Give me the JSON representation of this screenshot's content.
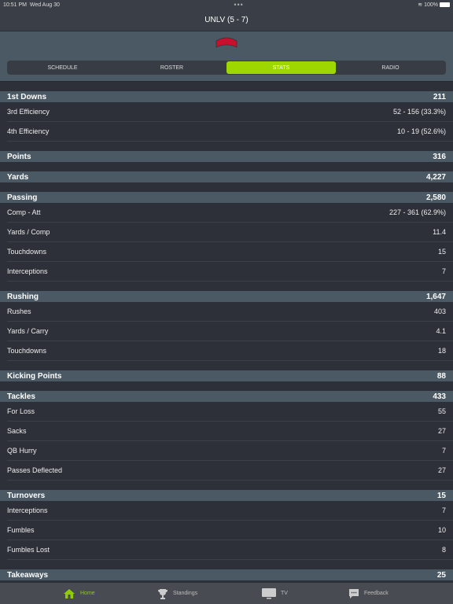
{
  "status": {
    "time": "10:51 PM",
    "date": "Wed Aug 30",
    "battery": "100%"
  },
  "nav": {
    "title": "UNLV (5 - 7)"
  },
  "logo": {
    "text": "UNLV",
    "color": "#c8102e"
  },
  "tabs": [
    {
      "label": "SCHEDULE"
    },
    {
      "label": "ROSTER"
    },
    {
      "label": "STATS",
      "active": true
    },
    {
      "label": "RADIO"
    }
  ],
  "accent": "#9ed600",
  "sections": [
    {
      "title": "1st Downs",
      "value": "211",
      "rows": [
        {
          "label": "3rd Efficiency",
          "value": "52 - 156 (33.3%)"
        },
        {
          "label": "4th Efficiency",
          "value": "10 - 19 (52.6%)"
        }
      ]
    },
    {
      "title": "Points",
      "value": "316",
      "rows": []
    },
    {
      "title": "Yards",
      "value": "4,227",
      "rows": []
    },
    {
      "title": "Passing",
      "value": "2,580",
      "rows": [
        {
          "label": "Comp - Att",
          "value": "227 - 361 (62.9%)"
        },
        {
          "label": "Yards / Comp",
          "value": "11.4"
        },
        {
          "label": "Touchdowns",
          "value": "15"
        },
        {
          "label": "Interceptions",
          "value": "7"
        }
      ]
    },
    {
      "title": "Rushing",
      "value": "1,647",
      "rows": [
        {
          "label": "Rushes",
          "value": "403"
        },
        {
          "label": "Yards / Carry",
          "value": "4.1"
        },
        {
          "label": "Touchdowns",
          "value": "18"
        }
      ]
    },
    {
      "title": "Kicking Points",
      "value": "88",
      "rows": []
    },
    {
      "title": "Tackles",
      "value": "433",
      "rows": [
        {
          "label": "For Loss",
          "value": "55"
        },
        {
          "label": "Sacks",
          "value": "27"
        },
        {
          "label": "QB Hurry",
          "value": "7"
        },
        {
          "label": "Passes Deflected",
          "value": "27"
        }
      ]
    },
    {
      "title": "Turnovers",
      "value": "15",
      "rows": [
        {
          "label": "Interceptions",
          "value": "7"
        },
        {
          "label": "Fumbles",
          "value": "10"
        },
        {
          "label": "Fumbles Lost",
          "value": "8"
        }
      ]
    },
    {
      "title": "Takeaways",
      "value": "25",
      "rows": []
    }
  ],
  "tabbar": [
    {
      "label": "Home",
      "icon": "home-icon",
      "active": true
    },
    {
      "label": "Standings",
      "icon": "trophy-icon"
    },
    {
      "label": "TV",
      "icon": "tv-icon"
    },
    {
      "label": "Feedback",
      "icon": "chat-icon"
    }
  ]
}
